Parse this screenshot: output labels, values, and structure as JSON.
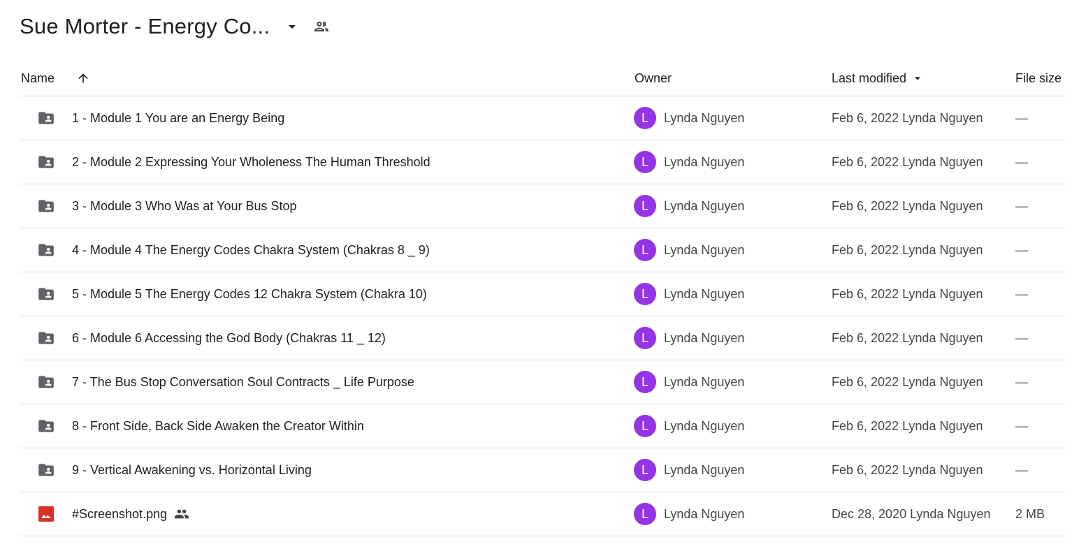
{
  "folder": {
    "title": "Sue Morter - Energy Co...",
    "caret_icon": "arrow-drop-down-icon",
    "shared_icon": "people-outline-icon"
  },
  "columns": {
    "name": "Name",
    "name_sort_icon": "arrow-up-icon",
    "owner": "Owner",
    "last_modified": "Last modified",
    "last_modified_sort_icon": "arrow-drop-down-icon",
    "file_size": "File size"
  },
  "colors": {
    "folder_icon": "#5f6368",
    "image_icon": "#d93025",
    "avatar": "#9334e6",
    "divider": "#dadce0"
  },
  "rows": [
    {
      "type": "shared-folder",
      "icon": "shared-folder-icon",
      "name": "1 - Module 1 You are an Energy Being",
      "owner_initial": "L",
      "owner": "Lynda Nguyen",
      "modified": "Feb 6, 2022 Lynda Nguyen",
      "size": "—",
      "shared": false
    },
    {
      "type": "shared-folder",
      "icon": "shared-folder-icon",
      "name": "2 - Module 2 Expressing Your Wholeness The Human Threshold",
      "owner_initial": "L",
      "owner": "Lynda Nguyen",
      "modified": "Feb 6, 2022 Lynda Nguyen",
      "size": "—",
      "shared": false
    },
    {
      "type": "shared-folder",
      "icon": "shared-folder-icon",
      "name": "3 - Module 3 Who Was at Your Bus Stop",
      "owner_initial": "L",
      "owner": "Lynda Nguyen",
      "modified": "Feb 6, 2022 Lynda Nguyen",
      "size": "—",
      "shared": false
    },
    {
      "type": "shared-folder",
      "icon": "shared-folder-icon",
      "name": "4 - Module 4 The Energy Codes Chakra System (Chakras 8 _ 9)",
      "owner_initial": "L",
      "owner": "Lynda Nguyen",
      "modified": "Feb 6, 2022 Lynda Nguyen",
      "size": "—",
      "shared": false
    },
    {
      "type": "shared-folder",
      "icon": "shared-folder-icon",
      "name": "5 - Module 5 The Energy Codes 12 Chakra System (Chakra 10)",
      "owner_initial": "L",
      "owner": "Lynda Nguyen",
      "modified": "Feb 6, 2022 Lynda Nguyen",
      "size": "—",
      "shared": false
    },
    {
      "type": "shared-folder",
      "icon": "shared-folder-icon",
      "name": "6 - Module 6 Accessing the God Body (Chakras 11 _ 12)",
      "owner_initial": "L",
      "owner": "Lynda Nguyen",
      "modified": "Feb 6, 2022 Lynda Nguyen",
      "size": "—",
      "shared": false
    },
    {
      "type": "shared-folder",
      "icon": "shared-folder-icon",
      "name": "7 - The Bus Stop Conversation Soul Contracts _ Life Purpose",
      "owner_initial": "L",
      "owner": "Lynda Nguyen",
      "modified": "Feb 6, 2022 Lynda Nguyen",
      "size": "—",
      "shared": false
    },
    {
      "type": "shared-folder",
      "icon": "shared-folder-icon",
      "name": "8 - Front Side, Back Side Awaken the Creator Within",
      "owner_initial": "L",
      "owner": "Lynda Nguyen",
      "modified": "Feb 6, 2022 Lynda Nguyen",
      "size": "—",
      "shared": false
    },
    {
      "type": "shared-folder",
      "icon": "shared-folder-icon",
      "name": "9 - Vertical Awakening vs. Horizontal Living",
      "owner_initial": "L",
      "owner": "Lynda Nguyen",
      "modified": "Feb 6, 2022 Lynda Nguyen",
      "size": "—",
      "shared": false
    },
    {
      "type": "image",
      "icon": "image-file-icon",
      "name": "#Screenshot.png",
      "owner_initial": "L",
      "owner": "Lynda Nguyen",
      "modified": "Dec 28, 2020 Lynda Nguyen",
      "size": "2 MB",
      "shared": true
    }
  ]
}
